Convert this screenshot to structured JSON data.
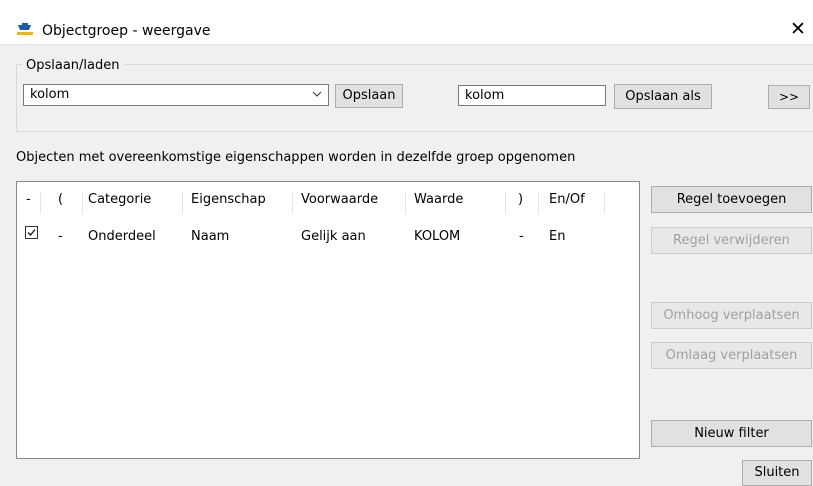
{
  "window": {
    "title": "Objectgroep - weergave",
    "icon": "app-icon"
  },
  "save_load": {
    "legend": "Opslaan/laden",
    "selected": "kolom",
    "save_label": "Opslaan",
    "name_value": "kolom",
    "save_as_label": "Opslaan als",
    "more_label": ">>"
  },
  "description": "Objecten met overeenkomstige eigenschappen worden in dezelfde groep opgenomen",
  "table": {
    "columns": [
      "-",
      "(",
      "Categorie",
      "Eigenschap",
      "Voorwaarde",
      "Waarde",
      ")",
      "En/Of"
    ],
    "rows": [
      {
        "checked": true,
        "cells": [
          "-",
          "Onderdeel",
          "Naam",
          "Gelijk aan",
          "KOLOM",
          "-",
          "En"
        ]
      }
    ]
  },
  "actions": {
    "add_rule": "Regel toevoegen",
    "remove_rule": "Regel verwijderen",
    "move_up": "Omhoog verplaatsen",
    "move_down": "Omlaag verplaatsen",
    "new_filter": "Nieuw filter",
    "close": "Sluiten"
  },
  "colors": {
    "window_bg": "#f0f0f0",
    "icon_blue": "#1a5aa8",
    "icon_yellow": "#f2b705"
  }
}
